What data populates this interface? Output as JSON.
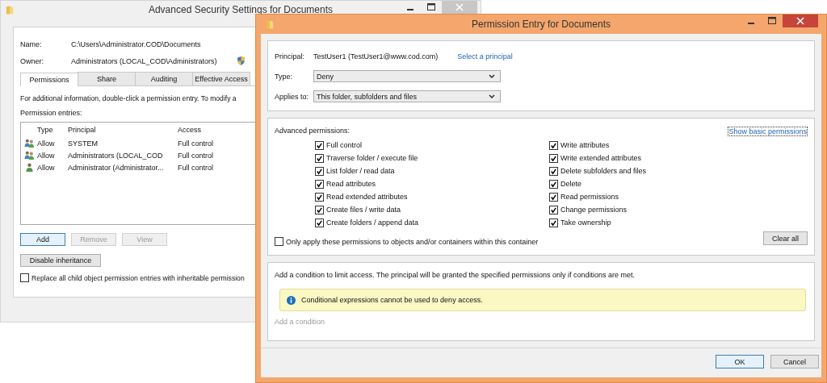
{
  "back_window": {
    "title": "Advanced Security Settings for Documents",
    "name_label": "Name:",
    "name_value": "C:\\Users\\Administrator.COD\\Documents",
    "owner_label": "Owner:",
    "owner_value": "Administrators (LOCAL_COD\\Administrators)",
    "tabs": [
      {
        "label": "Permissions",
        "selected": true
      },
      {
        "label": "Share",
        "selected": false
      },
      {
        "label": "Auditing",
        "selected": false
      },
      {
        "label": "Effective Access",
        "selected": false
      }
    ],
    "info_text": "For additional information, double-click a permission entry. To modify a",
    "entries_label": "Permission entries:",
    "table": {
      "columns": [
        "Type",
        "Principal",
        "Access"
      ],
      "rows": [
        {
          "kind": "group",
          "type": "Allow",
          "principal": "SYSTEM",
          "access": "Full control"
        },
        {
          "kind": "group",
          "type": "Allow",
          "principal": "Administrators (LOCAL_COD",
          "access": "Full control"
        },
        {
          "kind": "user",
          "type": "Allow",
          "principal": "Administrator (Administrator...",
          "access": "Full control"
        }
      ]
    },
    "buttons": [
      {
        "label": "Add",
        "disabled": false
      },
      {
        "label": "Remove",
        "disabled": true
      },
      {
        "label": "View",
        "disabled": true
      }
    ],
    "disable_inheritance_button": "Disable inheritance",
    "replace_checkbox": {
      "label": "Replace all child object permission entries with inheritable permission",
      "checked": false
    }
  },
  "front_window": {
    "title": "Permission Entry for Documents",
    "principal_label": "Principal:",
    "principal_value": "TestUser1 (TestUser1@www.cod.com)",
    "select_principal_link": "Select a principal",
    "type": {
      "label": "Type:",
      "value": "Deny"
    },
    "applies_to": {
      "label": "Applies to:",
      "value": "This folder, subfolders and files"
    },
    "advanced_label": "Advanced permissions:",
    "show_basic_link": "Show basic permissions",
    "permissions": [
      {
        "label": "Full control",
        "checked": true
      },
      {
        "label": "Traverse folder / execute file",
        "checked": true
      },
      {
        "label": "List folder / read data",
        "checked": true
      },
      {
        "label": "Read attributes",
        "checked": true
      },
      {
        "label": "Read extended attributes",
        "checked": true
      },
      {
        "label": "Create files / write data",
        "checked": true
      },
      {
        "label": "Create folders / append data",
        "checked": true
      },
      {
        "label": "Write attributes",
        "checked": true
      },
      {
        "label": "Write extended attributes",
        "checked": true
      },
      {
        "label": "Delete subfolders and files",
        "checked": true
      },
      {
        "label": "Delete",
        "checked": true
      },
      {
        "label": "Read permissions",
        "checked": true
      },
      {
        "label": "Change permissions",
        "checked": true
      },
      {
        "label": "Take ownership",
        "checked": true
      }
    ],
    "only_apply": {
      "label": "Only apply these permissions to objects and/or containers within this container",
      "checked": false
    },
    "clear_all_button": "Clear all",
    "condition_text": "Add a condition to limit access. The principal will be granted the specified permissions only if conditions are met.",
    "info_message": "Conditional expressions cannot be used to deny access.",
    "add_condition": {
      "label": "Add a condition",
      "disabled": true
    },
    "buttons": [
      "OK",
      "Cancel"
    ]
  }
}
